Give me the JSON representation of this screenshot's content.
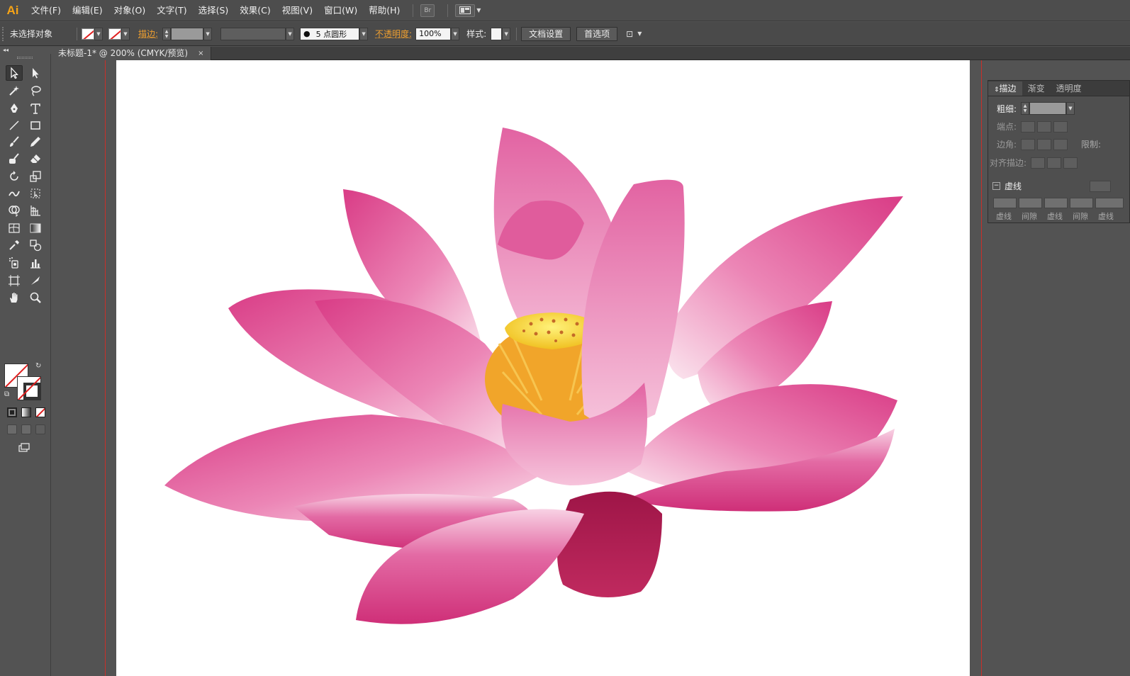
{
  "app": {
    "logo": "Ai",
    "accent": "#f7a416"
  },
  "menu": [
    "文件(F)",
    "编辑(E)",
    "对象(O)",
    "文字(T)",
    "选择(S)",
    "效果(C)",
    "视图(V)",
    "窗口(W)",
    "帮助(H)"
  ],
  "menubar_buttons": {
    "bridge": "Br"
  },
  "control": {
    "selection": "未选择对象",
    "stroke_label": "描边:",
    "brush": "5 点圆形",
    "opacity_label": "不透明度:",
    "opacity_value": "100%",
    "style_label": "样式:",
    "doc_setup": "文档设置",
    "preferences": "首选项"
  },
  "document": {
    "tab_title": "未标题-1* @ 200% (CMYK/预览)",
    "close": "×"
  },
  "panel": {
    "tabs": [
      "描边",
      "渐变",
      "透明度"
    ],
    "weight_label": "粗细:",
    "cap_label": "端点:",
    "corner_label": "边角:",
    "limit_label": "限制:",
    "align_label": "对齐描边:",
    "dashed_label": "虚线",
    "dash_labels": [
      "虚线",
      "间隙",
      "虚线",
      "间隙",
      "虚线"
    ]
  },
  "tool_icons": [
    "selection-icon",
    "direct-selection-icon",
    "magic-wand-icon",
    "lasso-icon",
    "pen-icon",
    "type-icon",
    "line-icon",
    "rectangle-icon",
    "paintbrush-icon",
    "pencil-icon",
    "blob-brush-icon",
    "eraser-icon",
    "rotate-icon",
    "scale-icon",
    "warp-icon",
    "free-transform-icon",
    "shape-builder-icon",
    "perspective-grid-icon",
    "mesh-icon",
    "gradient-icon",
    "eyedropper-icon",
    "blend-icon",
    "symbol-sprayer-icon",
    "column-graph-icon",
    "artboard-icon",
    "slice-icon",
    "hand-icon",
    "zoom-icon"
  ],
  "colors": {
    "petal": "#e0508f",
    "petal_light": "#f6c6dc",
    "seedpod": "#f5e040",
    "stamen": "#f0a020",
    "bleed_line": "#c8302a"
  }
}
